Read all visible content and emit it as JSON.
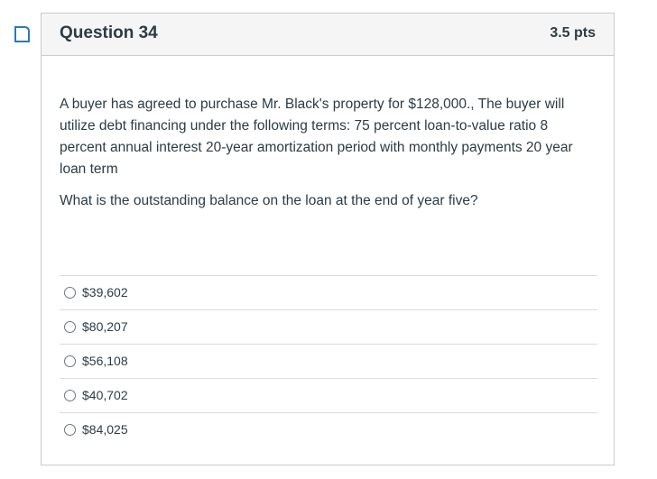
{
  "question": {
    "title": "Question 34",
    "points": "3.5 pts",
    "text": "A buyer has agreed to purchase Mr. Black's property for $128,000., The buyer will utilize debt financing under the following terms: 75 percent loan-to-value ratio 8 percent annual interest 20-year amortization period with monthly payments 20 year loan term",
    "prompt": "What is the outstanding balance on the loan at the end of year five?"
  },
  "answers": [
    {
      "label": "$39,602"
    },
    {
      "label": "$80,207"
    },
    {
      "label": "$56,108"
    },
    {
      "label": "$40,702"
    },
    {
      "label": "$84,025"
    }
  ],
  "colors": {
    "flag": "#2b7abc",
    "header_bg": "#f5f5f5",
    "border": "#c7cdd1",
    "text": "#2d3b45"
  },
  "icons": {
    "flag": "bookmark-flag-icon"
  }
}
